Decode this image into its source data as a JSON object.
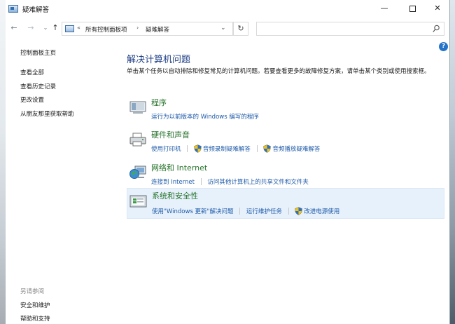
{
  "window": {
    "title": "疑难解答"
  },
  "titlebar": {
    "minimize": "—",
    "close": "✕"
  },
  "nav": {
    "back": "←",
    "forward": "→",
    "recent": "⌄",
    "up": "↑",
    "breadcrumb": {
      "prefix": "«",
      "item1": "所有控制面板项",
      "sep": "›",
      "item2": "疑难解答"
    },
    "dropdown": "⌄",
    "refresh": "↻",
    "search_placeholder": ""
  },
  "help": "?",
  "sidebar": {
    "home": "控制面板主页",
    "items": [
      "查看全部",
      "查看历史记录",
      "更改设置",
      "从朋友那里获取帮助"
    ],
    "see_also_title": "另请参阅",
    "see_also": [
      "安全和维护",
      "帮助和支持"
    ]
  },
  "main": {
    "title": "解决计算机问题",
    "description": "单击某个任务以自动排除和修复常见的计算机问题。若要查看更多的故障修复方案，请单击某个类别或使用搜索框。",
    "categories": [
      {
        "title": "程序",
        "links": [
          "运行为以前版本的 Windows 编写的程序"
        ]
      },
      {
        "title": "硬件和声音",
        "links": [
          "使用打印机",
          "音频录制疑难解答",
          "音频播放疑难解答"
        ]
      },
      {
        "title": "网络和 Internet",
        "links": [
          "连接到 Internet",
          "访问其他计算机上的共享文件和文件夹"
        ]
      },
      {
        "title": "系统和安全性",
        "links": [
          "使用\"Windows 更新\"解决问题",
          "运行维护任务",
          "改进电源使用"
        ]
      }
    ]
  },
  "colors": {
    "category_title": "#27732c",
    "link": "#1e5aa8",
    "heading": "#1f3f86",
    "selected_bg": "#e7f1fb"
  }
}
